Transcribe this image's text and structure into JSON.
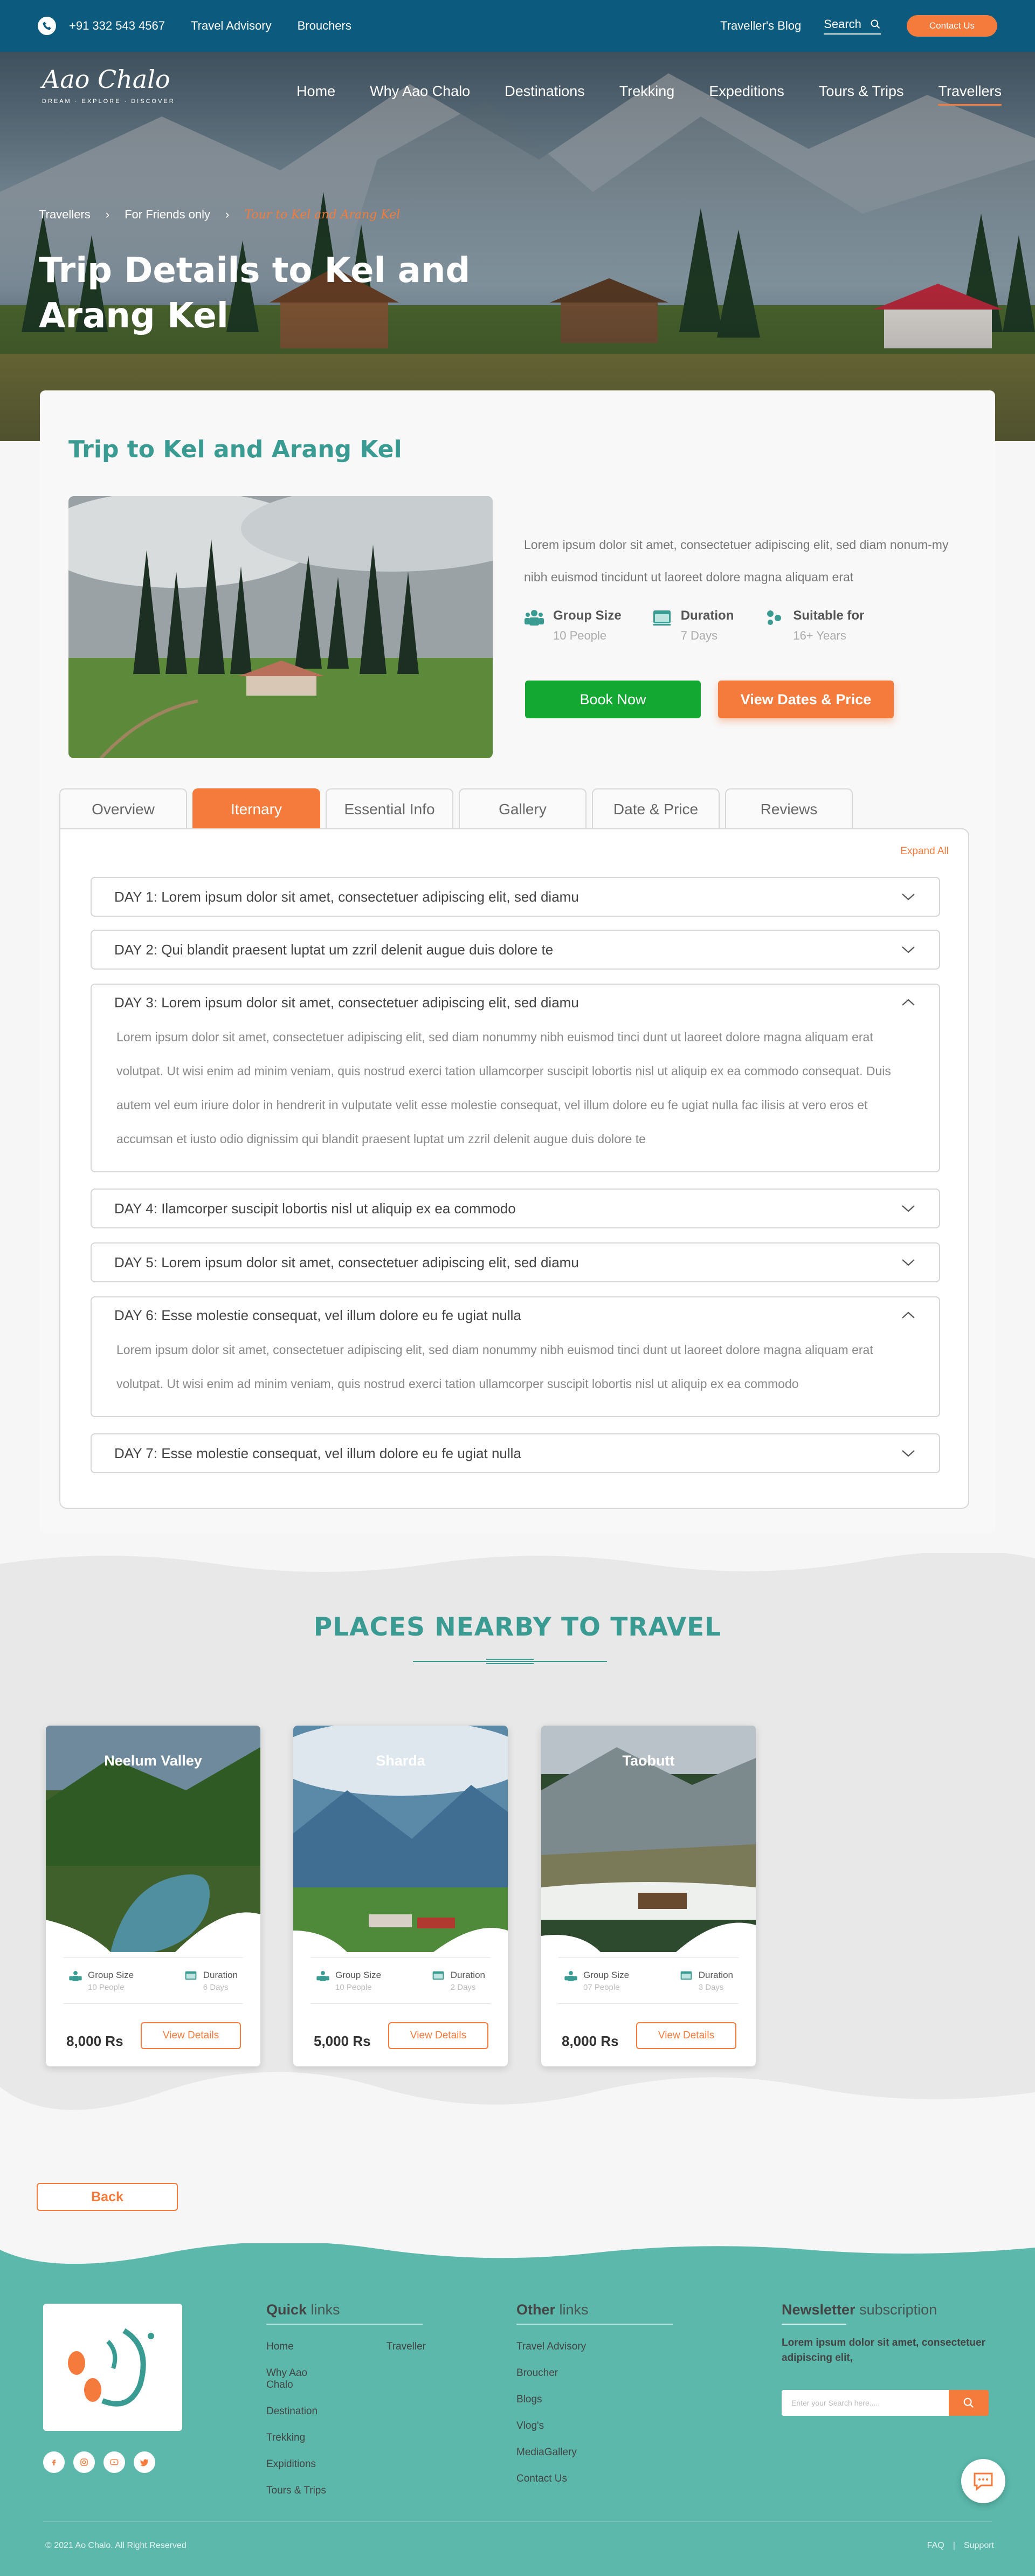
{
  "topbar": {
    "phone": "+91 332 543 4567",
    "links": [
      "Travel Advisory",
      "Brouchers"
    ],
    "blog": "Traveller's Blog",
    "search_label": "Search",
    "contact": "Contact Us"
  },
  "logo": {
    "text": "Aao Chalo",
    "tagline": "DREAM · EXPLORE · DISCOVER"
  },
  "mainnav": [
    "Home",
    "Why Aao Chalo",
    "Destinations",
    "Trekking",
    "Expeditions",
    "Tours & Trips",
    "Travellers"
  ],
  "breadcrumb": [
    "Travellers",
    "For Friends only",
    "Tour to Kel and Arang Kel"
  ],
  "hero_title": "Trip Details to Kel and Arang Kel",
  "trip": {
    "title": "Trip to Kel and Arang Kel",
    "description": "Lorem ipsum dolor sit amet, consectetuer adipiscing elit, sed diam nonum-my nibh euismod tincidunt ut laoreet dolore magna aliquam erat",
    "facts": [
      {
        "label": "Group Size",
        "value": "10 People",
        "icon": "group-icon"
      },
      {
        "label": "Duration",
        "value": "7 Days",
        "icon": "calendar-icon"
      },
      {
        "label": "Suitable for",
        "value": "16+ Years",
        "icon": "people-icon"
      }
    ],
    "book": "Book Now",
    "dates": "View Dates & Price"
  },
  "tabs": [
    "Overview",
    "Iternary",
    "Essential Info",
    "Gallery",
    "Date & Price",
    "Reviews"
  ],
  "expand_all": "Expand All",
  "days": [
    {
      "title": "DAY 1: Lorem ipsum dolor sit amet, consectetuer adipiscing elit, sed diamu",
      "open": false,
      "body": ""
    },
    {
      "title": "DAY 2: Qui blandit praesent luptat um zzril delenit augue duis dolore te",
      "open": false,
      "body": ""
    },
    {
      "title": "DAY 3: Lorem ipsum dolor sit amet, consectetuer adipiscing elit, sed diamu",
      "open": true,
      "body": "Lorem ipsum dolor sit amet, consectetuer adipiscing elit, sed diam nonummy nibh euismod tinci dunt ut laoreet dolore magna aliquam erat volutpat. Ut wisi enim ad minim veniam, quis nostrud exerci tation ullamcorper suscipit lobortis nisl ut aliquip ex ea commodo consequat. Duis autem vel eum iriure dolor in hendrerit in vulputate velit esse molestie consequat, vel illum dolore eu fe ugiat nulla fac ilisis at vero eros et accumsan et iusto odio dignissim qui blandit praesent luptat um zzril delenit augue duis dolore te"
    },
    {
      "title": "DAY 4: Ilamcorper suscipit lobortis nisl ut aliquip ex ea commodo",
      "open": false,
      "body": ""
    },
    {
      "title": "DAY 5: Lorem ipsum dolor sit amet, consectetuer adipiscing elit, sed diamu",
      "open": false,
      "body": ""
    },
    {
      "title": "DAY 6: Esse molestie consequat, vel illum dolore eu fe ugiat nulla",
      "open": true,
      "body": "Lorem ipsum dolor sit amet, consectetuer adipiscing elit, sed diam nonummy nibh euismod tinci dunt ut laoreet dolore magna aliquam erat volutpat. Ut wisi enim ad minim veniam, quis nostrud exerci tation ullamcorper suscipit lobortis nisl ut aliquip ex ea commodo"
    },
    {
      "title": "DAY 7: Esse molestie consequat, vel illum dolore eu fe ugiat nulla",
      "open": false,
      "body": ""
    }
  ],
  "nearby": {
    "title": "PLACES NEARBY TO TRAVEL",
    "places": [
      {
        "name": "Neelum Valley",
        "group": "10 People",
        "duration": "6 Days",
        "price": "8,000 Rs"
      },
      {
        "name": "Sharda",
        "group": "10 People",
        "duration": "2 Days",
        "price": "5,000 Rs"
      },
      {
        "name": "Taobutt",
        "group": "07 People",
        "duration": "3 Days",
        "price": "8,000 Rs"
      }
    ],
    "group_label": "Group Size",
    "duration_label": "Duration",
    "details": "View Details"
  },
  "back": "Back",
  "footer": {
    "quick_head": "Quick",
    "quick_head2": "links",
    "quick_col1": [
      "Home",
      "Why Aao Chalo",
      "Destination",
      "Trekking",
      "Expiditions",
      "Tours & Trips"
    ],
    "quick_col2": [
      "Traveller"
    ],
    "other_head": "Other",
    "other_head2": "links",
    "other": [
      "Travel Advisory",
      "Broucher",
      "Blogs",
      "Vlog's",
      "MediaGallery",
      "Contact Us"
    ],
    "news_head": "Newsletter",
    "news_head2": "subscription",
    "news_text": "Lorem ipsum dolor sit amet, consectetuer adipiscing elit,",
    "news_placeholder": "Enter your Search here.....",
    "copyright": "© 2021 Ao Chalo. All Right Reserved",
    "links": [
      "FAQ",
      "|",
      "Support"
    ],
    "socials": [
      "facebook-icon",
      "instagram-icon",
      "youtube-icon",
      "twitter-icon"
    ]
  },
  "colors": {
    "teal": "#3a9b93",
    "orange": "#f47b3c",
    "green": "#12a832",
    "navy": "#0c5a7d",
    "footer": "#5bb8ab"
  }
}
